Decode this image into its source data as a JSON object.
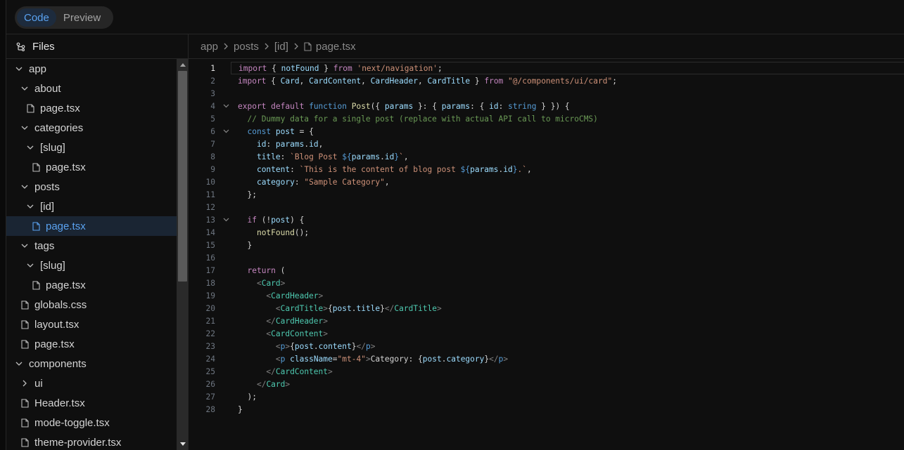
{
  "tabs": {
    "code": "Code",
    "preview": "Preview"
  },
  "sidebar": {
    "title": "Files",
    "tree": [
      {
        "label": "app",
        "type": "folder",
        "open": true,
        "depth": 0
      },
      {
        "label": "about",
        "type": "folder",
        "open": true,
        "depth": 1
      },
      {
        "label": "page.tsx",
        "type": "file",
        "depth": 2
      },
      {
        "label": "categories",
        "type": "folder",
        "open": true,
        "depth": 1
      },
      {
        "label": "[slug]",
        "type": "folder",
        "open": true,
        "depth": 2
      },
      {
        "label": "page.tsx",
        "type": "file",
        "depth": 3
      },
      {
        "label": "posts",
        "type": "folder",
        "open": true,
        "depth": 1
      },
      {
        "label": "[id]",
        "type": "folder",
        "open": true,
        "depth": 2
      },
      {
        "label": "page.tsx",
        "type": "file",
        "depth": 3,
        "selected": true
      },
      {
        "label": "tags",
        "type": "folder",
        "open": true,
        "depth": 1
      },
      {
        "label": "[slug]",
        "type": "folder",
        "open": true,
        "depth": 2
      },
      {
        "label": "page.tsx",
        "type": "file",
        "depth": 3
      },
      {
        "label": "globals.css",
        "type": "file",
        "depth": 1
      },
      {
        "label": "layout.tsx",
        "type": "file",
        "depth": 1
      },
      {
        "label": "page.tsx",
        "type": "file",
        "depth": 1
      },
      {
        "label": "components",
        "type": "folder",
        "open": true,
        "depth": 0
      },
      {
        "label": "ui",
        "type": "folder",
        "open": false,
        "depth": 1
      },
      {
        "label": "Header.tsx",
        "type": "file",
        "depth": 1
      },
      {
        "label": "mode-toggle.tsx",
        "type": "file",
        "depth": 1
      },
      {
        "label": "theme-provider.tsx",
        "type": "file",
        "depth": 1
      }
    ]
  },
  "breadcrumb": [
    "app",
    "posts",
    "[id]",
    "page.tsx"
  ],
  "editor": {
    "current_line": 1,
    "fold_lines": [
      4,
      6,
      13
    ],
    "lines": [
      [
        [
          "kw",
          "import"
        ],
        [
          "pl",
          " { "
        ],
        [
          "id",
          "notFound"
        ],
        [
          "pl",
          " } "
        ],
        [
          "kw",
          "from"
        ],
        [
          "pl",
          " "
        ],
        [
          "str",
          "'next/navigation'"
        ],
        [
          "pl",
          ";"
        ]
      ],
      [
        [
          "kw",
          "import"
        ],
        [
          "pl",
          " { "
        ],
        [
          "id",
          "Card"
        ],
        [
          "pl",
          ", "
        ],
        [
          "id",
          "CardContent"
        ],
        [
          "pl",
          ", "
        ],
        [
          "id",
          "CardHeader"
        ],
        [
          "pl",
          ", "
        ],
        [
          "id",
          "CardTitle"
        ],
        [
          "pl",
          " } "
        ],
        [
          "kw",
          "from"
        ],
        [
          "pl",
          " "
        ],
        [
          "str",
          "\"@/components/ui/card\""
        ],
        [
          "pl",
          ";"
        ]
      ],
      [],
      [
        [
          "kw",
          "export"
        ],
        [
          "pl",
          " "
        ],
        [
          "kw",
          "default"
        ],
        [
          "pl",
          " "
        ],
        [
          "kb",
          "function"
        ],
        [
          "pl",
          " "
        ],
        [
          "fn",
          "Post"
        ],
        [
          "pl",
          "({ "
        ],
        [
          "id",
          "params"
        ],
        [
          "pl",
          " }: { "
        ],
        [
          "id",
          "params"
        ],
        [
          "pl",
          ": { "
        ],
        [
          "id",
          "id"
        ],
        [
          "pl",
          ": "
        ],
        [
          "tp",
          "string"
        ],
        [
          "pl",
          " } }) {"
        ]
      ],
      [
        [
          "pl",
          "  "
        ],
        [
          "cm",
          "// Dummy data for a single post (replace with actual API call to microCMS)"
        ]
      ],
      [
        [
          "pl",
          "  "
        ],
        [
          "kb",
          "const"
        ],
        [
          "pl",
          " "
        ],
        [
          "id",
          "post"
        ],
        [
          "pl",
          " = {"
        ]
      ],
      [
        [
          "pl",
          "    "
        ],
        [
          "id",
          "id"
        ],
        [
          "pl",
          ": "
        ],
        [
          "id",
          "params"
        ],
        [
          "pl",
          "."
        ],
        [
          "id",
          "id"
        ],
        [
          "pl",
          ","
        ]
      ],
      [
        [
          "pl",
          "    "
        ],
        [
          "id",
          "title"
        ],
        [
          "pl",
          ": "
        ],
        [
          "str",
          "`Blog Post "
        ],
        [
          "kb",
          "${"
        ],
        [
          "id",
          "params"
        ],
        [
          "pl",
          "."
        ],
        [
          "id",
          "id"
        ],
        [
          "kb",
          "}"
        ],
        [
          "str",
          "`"
        ],
        [
          "pl",
          ","
        ]
      ],
      [
        [
          "pl",
          "    "
        ],
        [
          "id",
          "content"
        ],
        [
          "pl",
          ": "
        ],
        [
          "str",
          "`This is the content of blog post "
        ],
        [
          "kb",
          "${"
        ],
        [
          "id",
          "params"
        ],
        [
          "pl",
          "."
        ],
        [
          "id",
          "id"
        ],
        [
          "kb",
          "}"
        ],
        [
          "str",
          ".`"
        ],
        [
          "pl",
          ","
        ]
      ],
      [
        [
          "pl",
          "    "
        ],
        [
          "id",
          "category"
        ],
        [
          "pl",
          ": "
        ],
        [
          "str",
          "\"Sample Category\""
        ],
        [
          "pl",
          ","
        ]
      ],
      [
        [
          "pl",
          "  };"
        ]
      ],
      [],
      [
        [
          "pl",
          "  "
        ],
        [
          "kw",
          "if"
        ],
        [
          "pl",
          " (!"
        ],
        [
          "id",
          "post"
        ],
        [
          "pl",
          ") {"
        ]
      ],
      [
        [
          "pl",
          "    "
        ],
        [
          "fn",
          "notFound"
        ],
        [
          "pl",
          "();"
        ]
      ],
      [
        [
          "pl",
          "  }"
        ]
      ],
      [],
      [
        [
          "pl",
          "  "
        ],
        [
          "kw",
          "return"
        ],
        [
          "pl",
          " ("
        ]
      ],
      [
        [
          "pl",
          "    "
        ],
        [
          "ang",
          "<"
        ],
        [
          "tag",
          "Card"
        ],
        [
          "ang",
          ">"
        ]
      ],
      [
        [
          "pl",
          "      "
        ],
        [
          "ang",
          "<"
        ],
        [
          "tag",
          "CardHeader"
        ],
        [
          "ang",
          ">"
        ]
      ],
      [
        [
          "pl",
          "        "
        ],
        [
          "ang",
          "<"
        ],
        [
          "tag",
          "CardTitle"
        ],
        [
          "ang",
          ">"
        ],
        [
          "pl",
          "{"
        ],
        [
          "id",
          "post"
        ],
        [
          "pl",
          "."
        ],
        [
          "id",
          "title"
        ],
        [
          "pl",
          "}"
        ],
        [
          "ang",
          "</"
        ],
        [
          "tag",
          "CardTitle"
        ],
        [
          "ang",
          ">"
        ]
      ],
      [
        [
          "pl",
          "      "
        ],
        [
          "ang",
          "</"
        ],
        [
          "tag",
          "CardHeader"
        ],
        [
          "ang",
          ">"
        ]
      ],
      [
        [
          "pl",
          "      "
        ],
        [
          "ang",
          "<"
        ],
        [
          "tag",
          "CardContent"
        ],
        [
          "ang",
          ">"
        ]
      ],
      [
        [
          "pl",
          "        "
        ],
        [
          "ang",
          "<"
        ],
        [
          "kb",
          "p"
        ],
        [
          "ang",
          ">"
        ],
        [
          "pl",
          "{"
        ],
        [
          "id",
          "post"
        ],
        [
          "pl",
          "."
        ],
        [
          "id",
          "content"
        ],
        [
          "pl",
          "}"
        ],
        [
          "ang",
          "</"
        ],
        [
          "kb",
          "p"
        ],
        [
          "ang",
          ">"
        ]
      ],
      [
        [
          "pl",
          "        "
        ],
        [
          "ang",
          "<"
        ],
        [
          "kb",
          "p"
        ],
        [
          "pl",
          " "
        ],
        [
          "id",
          "className"
        ],
        [
          "pl",
          "="
        ],
        [
          "str",
          "\"mt-4\""
        ],
        [
          "ang",
          ">"
        ],
        [
          "pl",
          "Category: {"
        ],
        [
          "id",
          "post"
        ],
        [
          "pl",
          "."
        ],
        [
          "id",
          "category"
        ],
        [
          "pl",
          "}"
        ],
        [
          "ang",
          "</"
        ],
        [
          "kb",
          "p"
        ],
        [
          "ang",
          ">"
        ]
      ],
      [
        [
          "pl",
          "      "
        ],
        [
          "ang",
          "</"
        ],
        [
          "tag",
          "CardContent"
        ],
        [
          "ang",
          ">"
        ]
      ],
      [
        [
          "pl",
          "    "
        ],
        [
          "ang",
          "</"
        ],
        [
          "tag",
          "Card"
        ],
        [
          "ang",
          ">"
        ]
      ],
      [
        [
          "pl",
          "  );"
        ]
      ],
      [
        [
          "pl",
          "}"
        ]
      ]
    ]
  }
}
